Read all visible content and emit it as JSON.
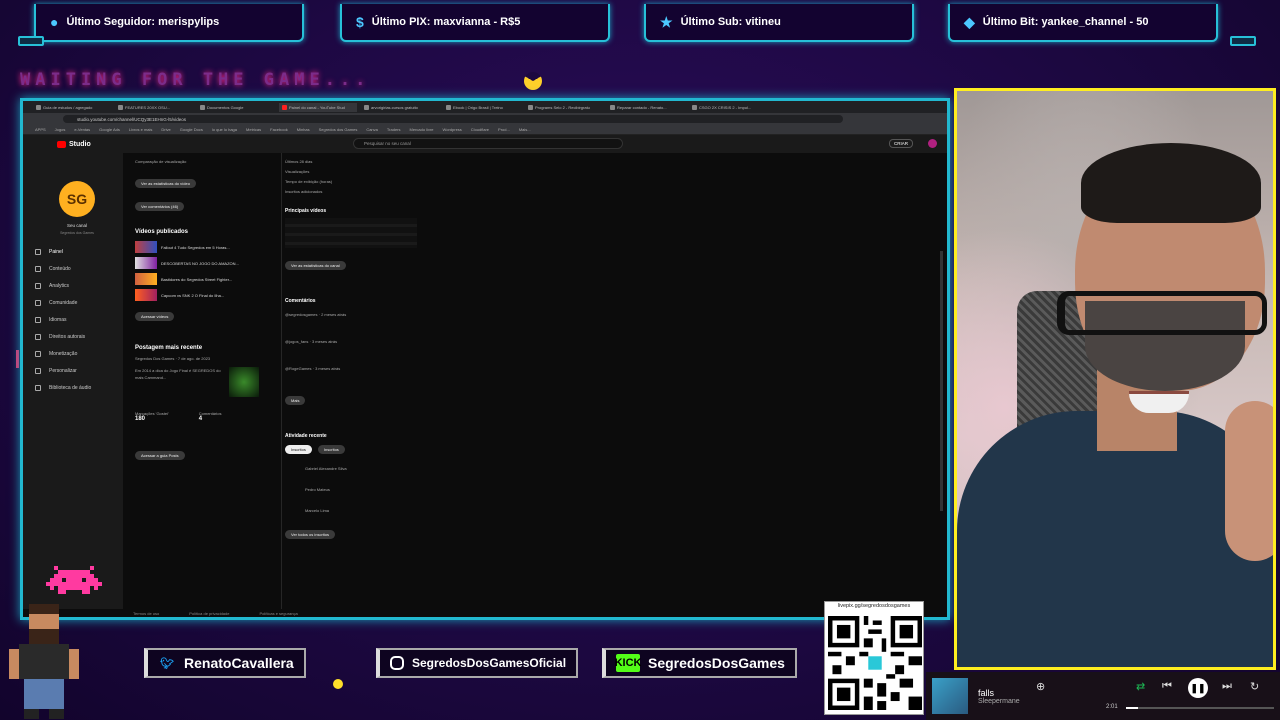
{
  "overlay": {
    "waiting_text": "WAITING FOR THE GAME...",
    "alerts": [
      {
        "icon": "user-icon",
        "text": "Último Seguidor: merispylips"
      },
      {
        "icon": "dollar-icon",
        "text": "Último PIX: maxvianna - R$5"
      },
      {
        "icon": "star-icon",
        "text": "Último Sub: vitineu"
      },
      {
        "icon": "diamond-icon",
        "text": "Último Bit: yankee_channel - 50"
      }
    ],
    "socials": [
      {
        "icon": "twitter-icon",
        "text": "RenatoCavallera"
      },
      {
        "icon": "instagram-icon",
        "text": "SegredosDosGamesOficial"
      },
      {
        "icon": "kick-icon",
        "icon_text": "KICK",
        "text": "SegredosDosGames"
      }
    ],
    "qr_label": "livepix.gg/segredosdosgames",
    "accent": "#22b8d0",
    "cam_border": "#ffee20"
  },
  "browser": {
    "tabs": [
      "Guia de estudos / agregado",
      "FEATURES 20XX OSU...",
      "Documentos Google",
      "Painel do canal - YouTube Stud",
      "arvorigirias.cursos gratuito",
      "Ebook | Origo Brasil | Treino",
      "Programs Selo 2 - Recibirgratu",
      "Reparar contado - Renato...",
      "CSGO 2X CRISIS 2 - Impul..."
    ],
    "url": "studio.youtube.com/channel/UCQy3E1EHnG-l5/videos",
    "bookmarks": [
      "APPS",
      "Jogos",
      "e-Ventas",
      "Google Ads",
      "Livros e mais",
      "Drive",
      "Google Docs",
      "lo que lo haga",
      "Metricas",
      "Facebook",
      "Minhas",
      "Segredos dos Games",
      "Canva",
      "Traders",
      "Mercado livre",
      "Wordpress",
      "Cloudflare",
      "Prod...",
      "Mais..."
    ]
  },
  "studio": {
    "logo_text": "Studio",
    "search_placeholder": "Pesquisar no seu canal",
    "create_label": "CRIAR",
    "channel_name": "Seu canal",
    "channel_sub": "Segredos dos Games",
    "nav": [
      "Painel",
      "Conteúdo",
      "Analytics",
      "Comunidade",
      "Idiomas",
      "Direitos autorais",
      "Monetização",
      "Personalizar",
      "Biblioteca de áudio"
    ],
    "col1": {
      "top_line": "Comparação de visualização",
      "btn_stats": "Ver as estatísticas do vídeo",
      "btn_comments": "Ver comentários (46)",
      "videos_title": "Vídeos publicados",
      "videos": [
        "Fallout 4 Tudo Segredos em 5 Horas...",
        "DESCOBERTAS NO JOGO DO AMAZON...",
        "Bastidores do Segredos Street Fighter...",
        "Capcom vs SNK 2 O Final do Ilha..."
      ],
      "btn_all": "Acessar vídeos",
      "post_title": "Postagem mais recente",
      "post_author": "Segredos Dos Games · 7 de ago. de 2023",
      "post_text": "Em 2014 a dica do Jogo Final é SEGREDOS do mais Cammand...",
      "likes_label": "Marcações 'Gostei'",
      "likes": "180",
      "comments_label": "Comentários",
      "comments": "4",
      "btn_post": "Acessar a guia Posts"
    },
    "col2": {
      "period": "Últimos 28 dias",
      "views_label": "Visualizações",
      "watch_label": "Tempo de exibição (horas)",
      "subs_label": "Inscritos adicionados",
      "top_title": "Principais vídeos",
      "btn_analytics": "Ver as estatísticas do canal",
      "comments_title": "Comentários",
      "comments": [
        "@segredosgames · 2 meses atrás",
        "@jogos_fans · 3 meses atrás",
        "@RogeGames · 3 meses atrás"
      ],
      "btn_more": "Mais",
      "activity_title": "Atividade recente",
      "tab_subs": "Inscritos",
      "tab_all": "Inscritos",
      "members": [
        "Gabriel Alexandre Silva",
        "Pedro Mateus",
        "Marcelo Lima"
      ],
      "btn_see_all": "Ver todos os inscritos"
    },
    "status_bar": [
      "Termos de uso",
      "Política de privacidade",
      "Políticas e segurança"
    ]
  },
  "player": {
    "title": "falls",
    "artist": "Sleepermane",
    "time": "2:01",
    "progress": 0.08
  }
}
